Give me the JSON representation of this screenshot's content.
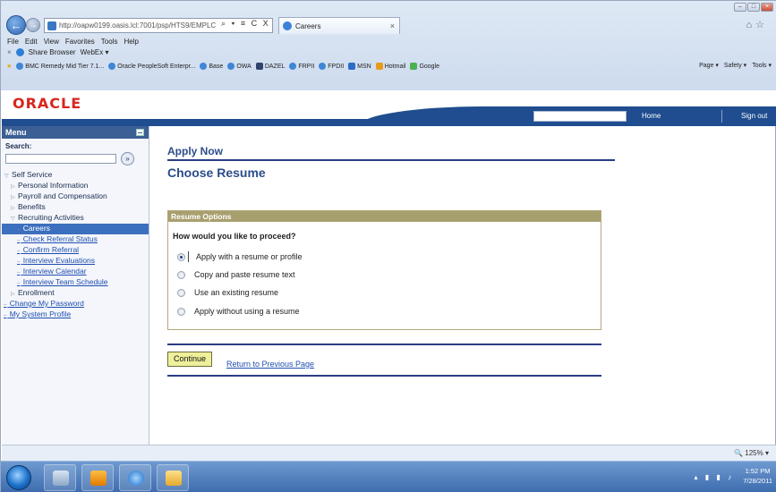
{
  "browser": {
    "address": "http://oapw0199.oasis.lcl:7001/psp/HTS9/EMPLC",
    "address_controls": "⌕ ▾ ≡ C X",
    "tab_title": "Careers",
    "tab_close": "×",
    "menubar": [
      "File",
      "Edit",
      "View",
      "Favorites",
      "Tools",
      "Help"
    ],
    "share_close": "×",
    "share_label": "Share Browser",
    "webex_label": "WebEx ▾",
    "favorites": [
      "BMC Remedy Mid Tier 7.1...",
      "Oracle PeopleSoft Enterpr...",
      "Base",
      "OWA",
      "DAZEL",
      "FRPII",
      "FPDII",
      "MSN",
      "Hotmail",
      "Google"
    ],
    "commands": [
      "Page ▾",
      "Safety ▾",
      "Tools ▾"
    ],
    "zoom": "125%"
  },
  "header": {
    "logo": "ORACLE",
    "home": "Home",
    "sign_out": "Sign out"
  },
  "menu": {
    "title": "Menu",
    "search_label": "Search:",
    "search_go": "»",
    "items": [
      {
        "label": "Self Service",
        "level": "l0",
        "prefix": "▽"
      },
      {
        "label": "Personal Information",
        "level": "l1",
        "prefix": "▷"
      },
      {
        "label": "Payroll and Compensation",
        "level": "l1",
        "prefix": "▷"
      },
      {
        "label": "Benefits",
        "level": "l1",
        "prefix": "▷"
      },
      {
        "label": "Recruiting Activities",
        "level": "l1",
        "prefix": "▽"
      },
      {
        "label": "Careers",
        "level": "l2 sel",
        "prefix": "–"
      },
      {
        "label": "Check Referral Status",
        "level": "l2",
        "prefix": "–"
      },
      {
        "label": "Confirm Referral",
        "level": "l2",
        "prefix": "–"
      },
      {
        "label": "Interview Evaluations",
        "level": "l2",
        "prefix": "–"
      },
      {
        "label": "Interview Calendar",
        "level": "l2",
        "prefix": "–"
      },
      {
        "label": "Interview Team Schedule",
        "level": "l2",
        "prefix": "–"
      },
      {
        "label": "Enrollment",
        "level": "l1",
        "prefix": "▷"
      },
      {
        "label": "Change My Password",
        "level": "link0",
        "prefix": "–"
      },
      {
        "label": "My System Profile",
        "level": "link0",
        "prefix": "–"
      }
    ]
  },
  "page": {
    "apply_now": "Apply Now",
    "title": "Choose Resume",
    "options_header": "Resume Options",
    "question": "How would you like to proceed?",
    "options": [
      {
        "label": "Apply with a resume or profile",
        "selected": true
      },
      {
        "label": "Copy and paste resume text",
        "selected": false
      },
      {
        "label": "Use an existing resume",
        "selected": false
      },
      {
        "label": "Apply without using a resume",
        "selected": false
      }
    ],
    "continue": "Continue",
    "return_link": "Return to Previous Page"
  },
  "taskbar": {
    "time": "1:52 PM",
    "date": "7/28/2011"
  }
}
